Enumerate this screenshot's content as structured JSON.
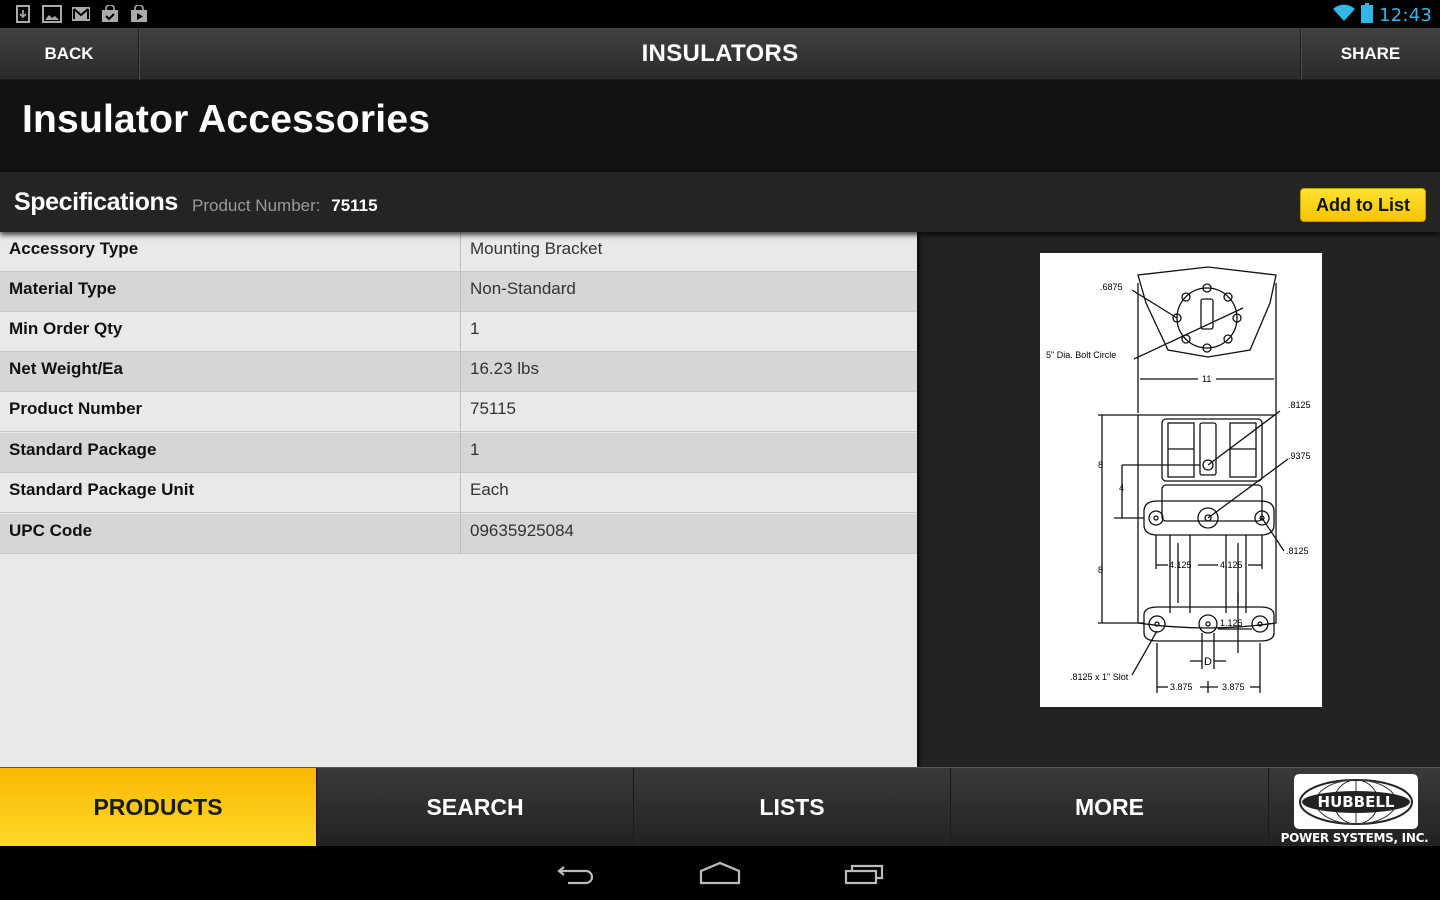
{
  "status_bar": {
    "notification_icons": [
      "download-icon",
      "gallery-icon",
      "gmail-icon",
      "store-update-icon",
      "play-store-icon"
    ],
    "time": "12:43",
    "accent_color": "#33b5e5"
  },
  "action_bar": {
    "back_label": "BACK",
    "title": "INSULATORS",
    "share_label": "SHARE"
  },
  "page": {
    "title": "Insulator Accessories"
  },
  "spec_header": {
    "title": "Specifications",
    "product_number_label": "Product Number:",
    "product_number_value": "75115",
    "add_to_list_label": "Add to List"
  },
  "specifications": [
    {
      "label": "Accessory Type",
      "value": "Mounting Bracket"
    },
    {
      "label": "Material Type",
      "value": "Non-Standard"
    },
    {
      "label": "Min Order Qty",
      "value": "1"
    },
    {
      "label": "Net Weight/Ea",
      "value": "16.23 lbs"
    },
    {
      "label": "Product Number",
      "value": "75115"
    },
    {
      "label": "Standard Package",
      "value": "1"
    },
    {
      "label": "Standard Package Unit",
      "value": "Each"
    },
    {
      "label": "UPC Code",
      "value": "09635925084"
    }
  ],
  "drawing": {
    "labels": {
      "hole_dia": ".6875",
      "bolt_circle": "5\" Dia. Bolt Circle",
      "width": "11",
      "top_right": ".8125",
      "center_hole": ".9375",
      "side_hole": ".8125",
      "height_upper": "8",
      "height_small": "4",
      "height_lower": "8",
      "spacing_left": "4.125",
      "spacing_right": "4.125",
      "slot_offset": "1.125",
      "slot": ".8125 x 1\" Slot",
      "d_label": "D",
      "bottom_left": "3.875",
      "bottom_right": "3.875"
    }
  },
  "tab_bar": {
    "tabs": [
      {
        "label": "PRODUCTS",
        "active": true
      },
      {
        "label": "SEARCH",
        "active": false
      },
      {
        "label": "LISTS",
        "active": false
      },
      {
        "label": "MORE",
        "active": false
      }
    ],
    "active_color": "#fcc800",
    "logo_text": "HUBBELL",
    "logo_subtext": "POWER SYSTEMS, INC."
  },
  "nav_bar": {
    "buttons": [
      "back-icon",
      "home-icon",
      "recent-apps-icon"
    ]
  }
}
